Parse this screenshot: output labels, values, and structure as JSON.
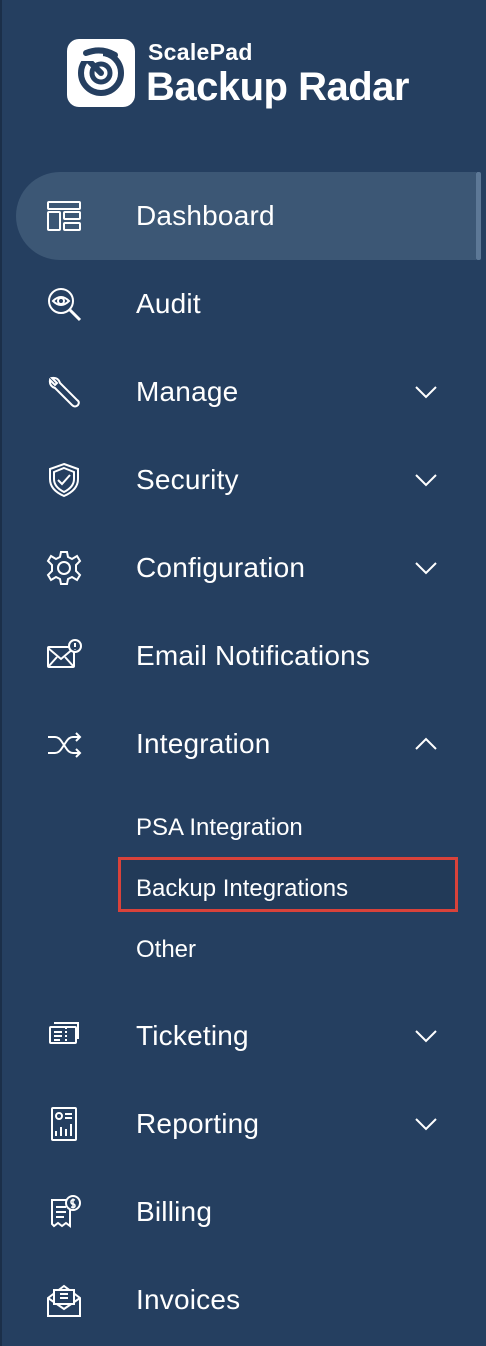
{
  "brand": {
    "company": "ScalePad",
    "product": "Backup Radar"
  },
  "sidebar": {
    "items": [
      {
        "label": "Dashboard",
        "icon": "dashboard-icon",
        "active": true,
        "expandable": false
      },
      {
        "label": "Audit",
        "icon": "audit-icon",
        "active": false,
        "expandable": false
      },
      {
        "label": "Manage",
        "icon": "wrench-icon",
        "active": false,
        "expandable": true,
        "expanded": false
      },
      {
        "label": "Security",
        "icon": "shield-icon",
        "active": false,
        "expandable": true,
        "expanded": false
      },
      {
        "label": "Configuration",
        "icon": "gear-icon",
        "active": false,
        "expandable": true,
        "expanded": false
      },
      {
        "label": "Email Notifications",
        "icon": "email-notification-icon",
        "active": false,
        "expandable": false
      },
      {
        "label": "Integration",
        "icon": "shuffle-icon",
        "active": false,
        "expandable": true,
        "expanded": true
      },
      {
        "label": "Ticketing",
        "icon": "ticket-icon",
        "active": false,
        "expandable": true,
        "expanded": false
      },
      {
        "label": "Reporting",
        "icon": "report-icon",
        "active": false,
        "expandable": true,
        "expanded": false
      },
      {
        "label": "Billing",
        "icon": "billing-icon",
        "active": false,
        "expandable": false
      },
      {
        "label": "Invoices",
        "icon": "invoice-icon",
        "active": false,
        "expandable": false
      }
    ],
    "integration_subitems": [
      {
        "label": "PSA Integration"
      },
      {
        "label": "Backup Integrations",
        "highlighted": true
      },
      {
        "label": "Other"
      }
    ]
  },
  "colors": {
    "background": "#253f60",
    "active_item": "#3c5775",
    "highlight_border": "#d9423a",
    "text": "#ffffff"
  }
}
